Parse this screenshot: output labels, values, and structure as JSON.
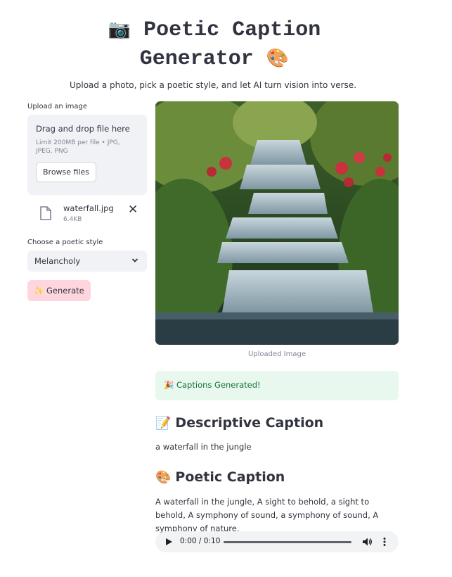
{
  "header": {
    "title_line1": "Poetic Caption",
    "title_line2": "Generator",
    "icon_camera": "camera-icon",
    "icon_palette": "palette-icon",
    "subtitle": "Upload a photo, pick a poetic style, and let AI turn vision into verse."
  },
  "uploader": {
    "label": "Upload an image",
    "drop_text": "Drag and drop file here",
    "limit_text": "Limit 200MB per file • JPG, JPEG, PNG",
    "browse_label": "Browse files",
    "file": {
      "name": "waterfall.jpg",
      "size": "6.4KB"
    }
  },
  "style_select": {
    "label": "Choose a poetic style",
    "selected": "Melancholy"
  },
  "generate_button": {
    "icon": "sparkles-icon",
    "label": "Generate"
  },
  "image": {
    "caption": "Uploaded Image"
  },
  "success": {
    "icon": "party-icon",
    "text": "Captions Generated!"
  },
  "descriptive": {
    "icon": "memo-icon",
    "heading": "Descriptive Caption",
    "text": "a waterfall in the jungle"
  },
  "poetic": {
    "icon": "palette-icon",
    "heading": "Poetic Caption",
    "text": "A waterfall in the jungle, A sight to behold, a sight to behold, A symphony of sound, a symphony of sound, A symphony of nature,"
  },
  "audio": {
    "time": "0:00 / 0:10",
    "progress": 0
  },
  "colors": {
    "accent_button": "#ffd6dd",
    "success_bg": "#e8f8ee",
    "success_text": "#177233"
  }
}
